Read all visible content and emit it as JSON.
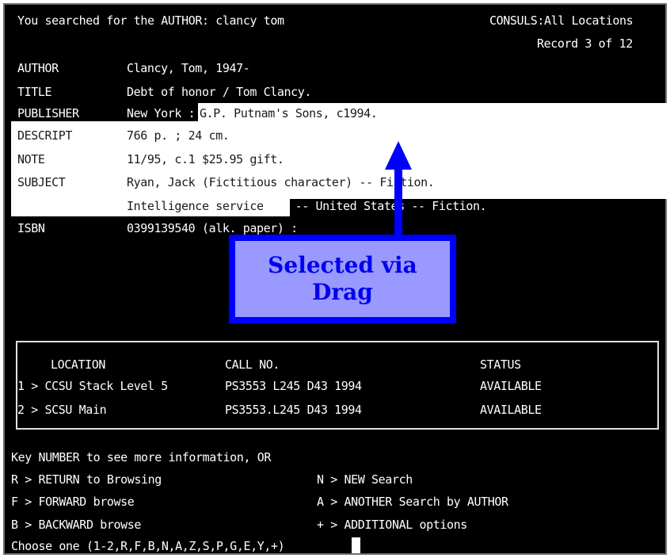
{
  "header": {
    "search_line": "You searched for the AUTHOR: clancy tom",
    "location": "CONSULS:All Locations",
    "record": "Record 3 of 12"
  },
  "record_fields": [
    {
      "label": "AUTHOR",
      "value": "Clancy, Tom, 1947-"
    },
    {
      "label": "TITLE",
      "value": "Debt of honor / Tom Clancy."
    },
    {
      "label": "PUBLISHER",
      "value_unselected": "New York : ",
      "value_selected": "G.P. Putnam's Sons, c1994."
    },
    {
      "label": "DESCRIPT",
      "value": "766 p. ; 24 cm."
    },
    {
      "label": "NOTE",
      "value": "11/95, c.1 $25.95 gift."
    },
    {
      "label": "SUBJECT",
      "value": "Ryan, Jack (Fictitious character) -- Fiction."
    },
    {
      "label": "",
      "value_selected": "Intelligence service",
      "value_unselected": " -- United States -- Fiction."
    },
    {
      "label": "ISBN",
      "value": "0399139540 (alk. paper) :"
    }
  ],
  "callout": {
    "text": "Selected via\nDrag",
    "color": "#0000ff"
  },
  "holdings": {
    "headers": [
      "LOCATION",
      "CALL NO.",
      "STATUS"
    ],
    "rows": [
      {
        "location": "1 > CCSU Stack Level 5",
        "call_no": "PS3553 L245 D43 1994",
        "status": "AVAILABLE"
      },
      {
        "location": "2 > SCSU Main",
        "call_no": "PS3553.L245 D43 1994",
        "status": "AVAILABLE"
      }
    ]
  },
  "menu": {
    "prompt": "Key NUMBER to see more information, OR",
    "options_left": [
      "R > RETURN to Browsing",
      "F > FORWARD browse",
      "B > BACKWARD browse"
    ],
    "options_right": [
      "N > NEW Search",
      "A > ANOTHER Search by AUTHOR",
      "+ > ADDITIONAL options"
    ],
    "choose": "Choose one (1-2,R,F,B,N,A,Z,S,P,G,E,Y,+)"
  }
}
